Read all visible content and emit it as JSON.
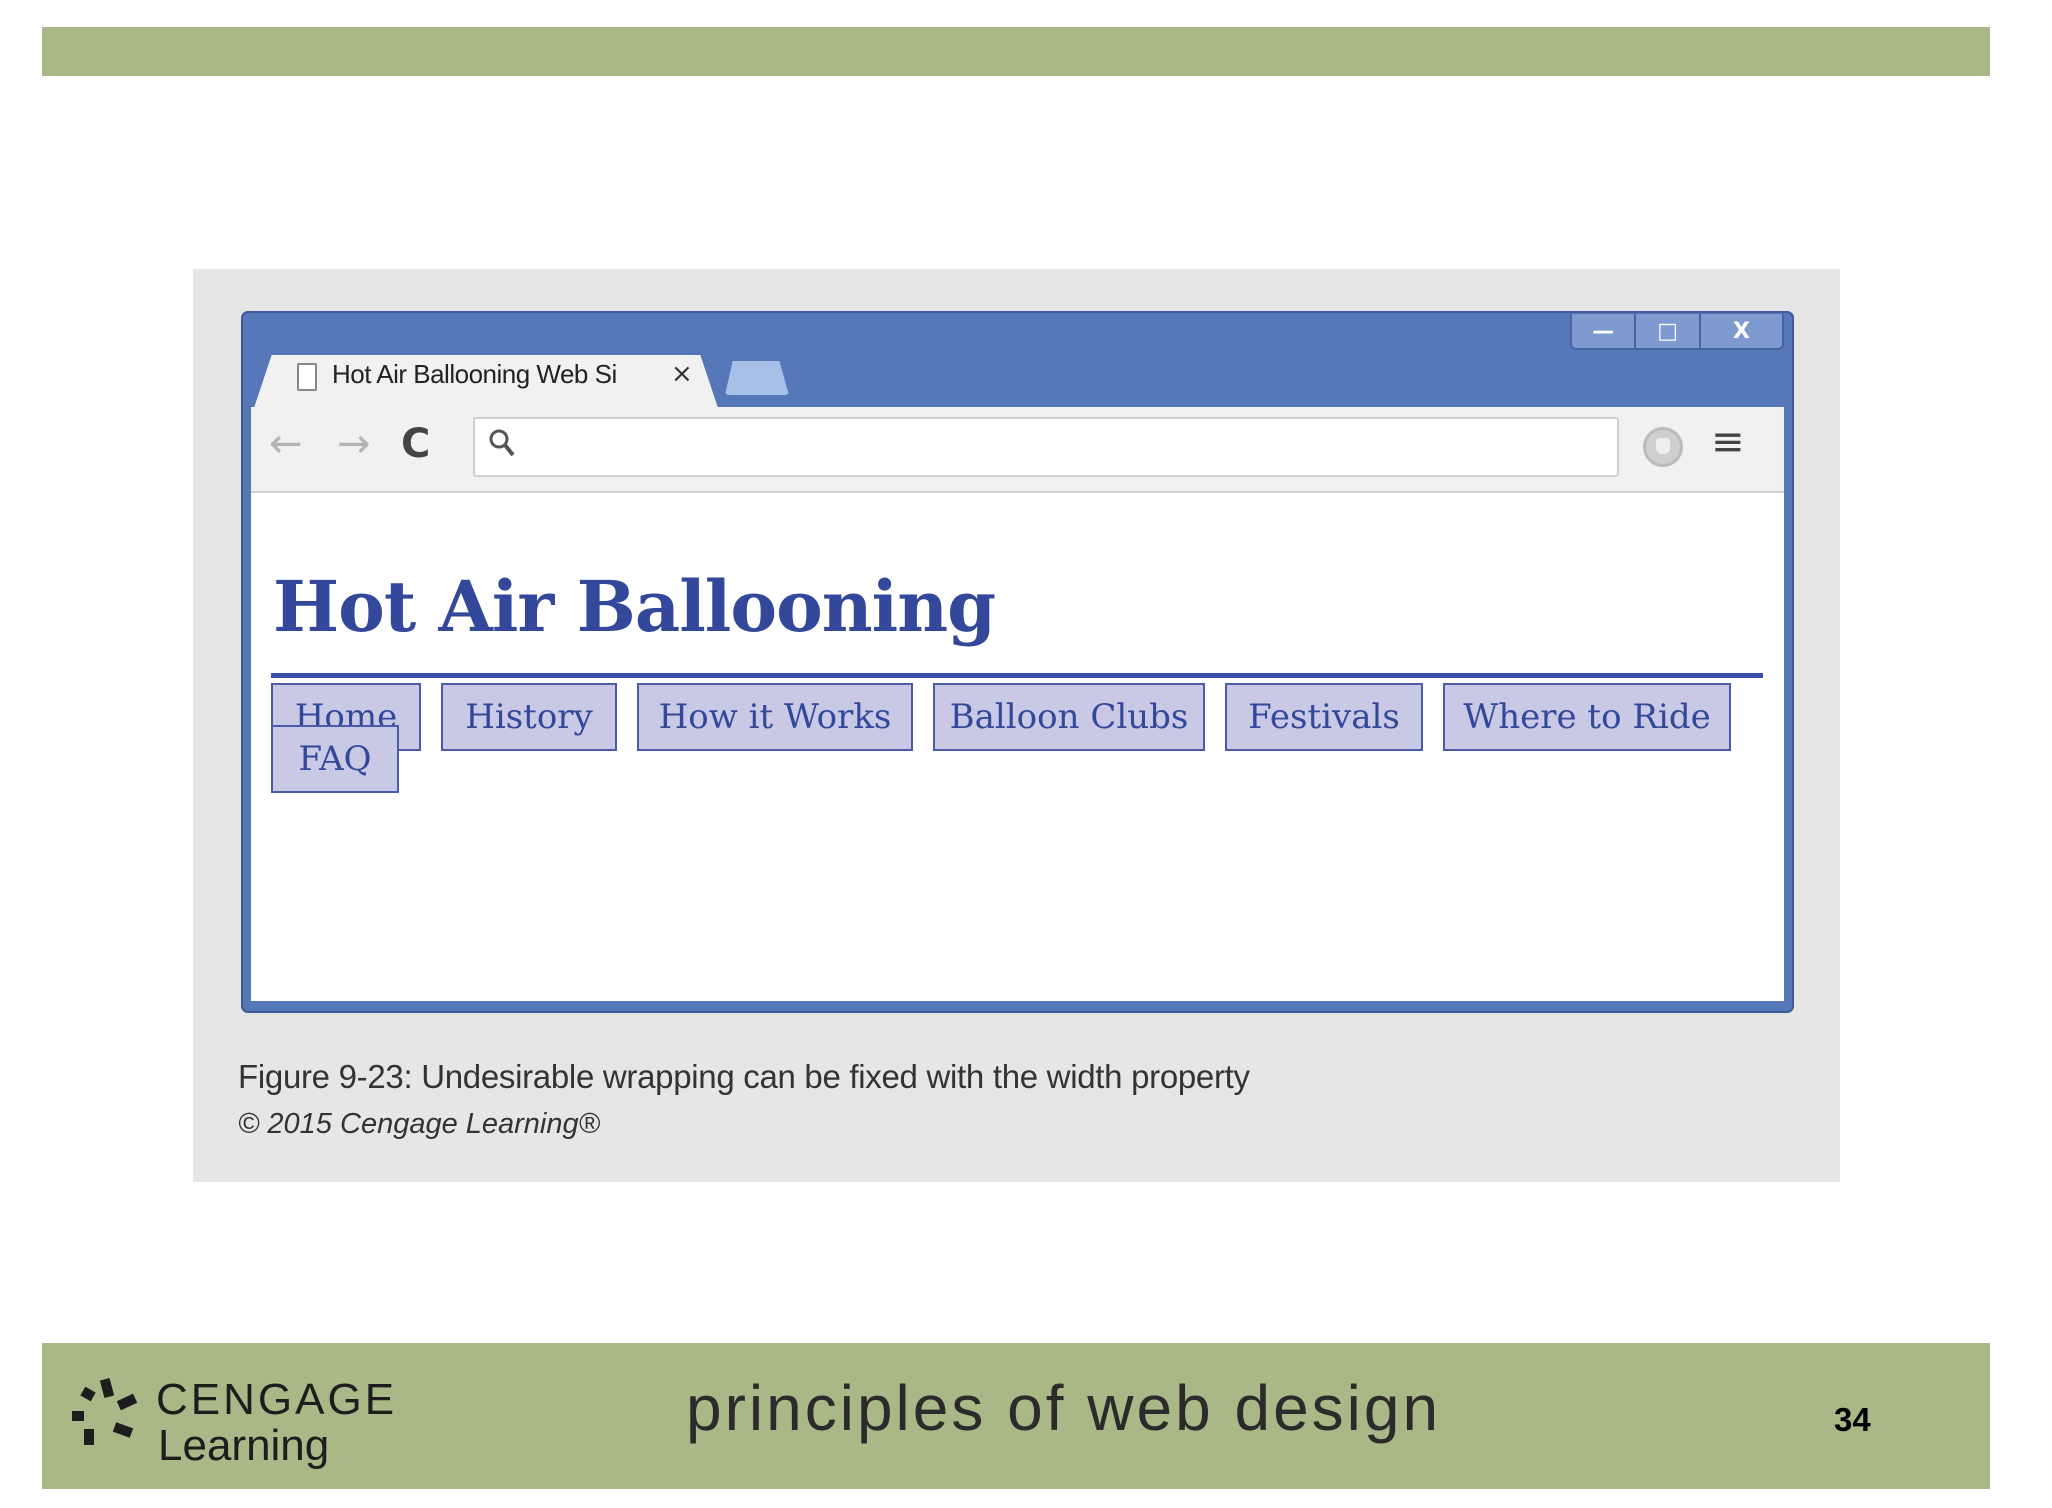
{
  "slide": {
    "colors": {
      "band": "#a9b887",
      "panel": "#e6e6e6"
    },
    "course_title": "principles of web design",
    "page_number": "34",
    "logo": {
      "name": "CENGAGE",
      "sub": "Learning"
    }
  },
  "figure": {
    "caption": "Figure 9-23: Undesirable wrapping can be fixed with the width property",
    "copyright": "© 2015 Cengage Learning®"
  },
  "browser": {
    "tab_title": "Hot Air Ballooning Web Si",
    "tab_close": "×",
    "window_controls": {
      "minimize": "—",
      "maximize": "□",
      "close": "X"
    },
    "omnibox_value": "",
    "icons": {
      "back": "←",
      "forward": "→",
      "reload": "C",
      "search": "⚲",
      "menu": "≡"
    }
  },
  "page": {
    "heading": "Hot Air Ballooning",
    "nav": [
      "Home",
      "History",
      "How it Works",
      "Balloon Clubs",
      "Festivals",
      "Where to Ride",
      "FAQ"
    ],
    "colors": {
      "text": "#33479b",
      "button_bg": "#c9c9e6",
      "rule": "#3850a6"
    }
  }
}
